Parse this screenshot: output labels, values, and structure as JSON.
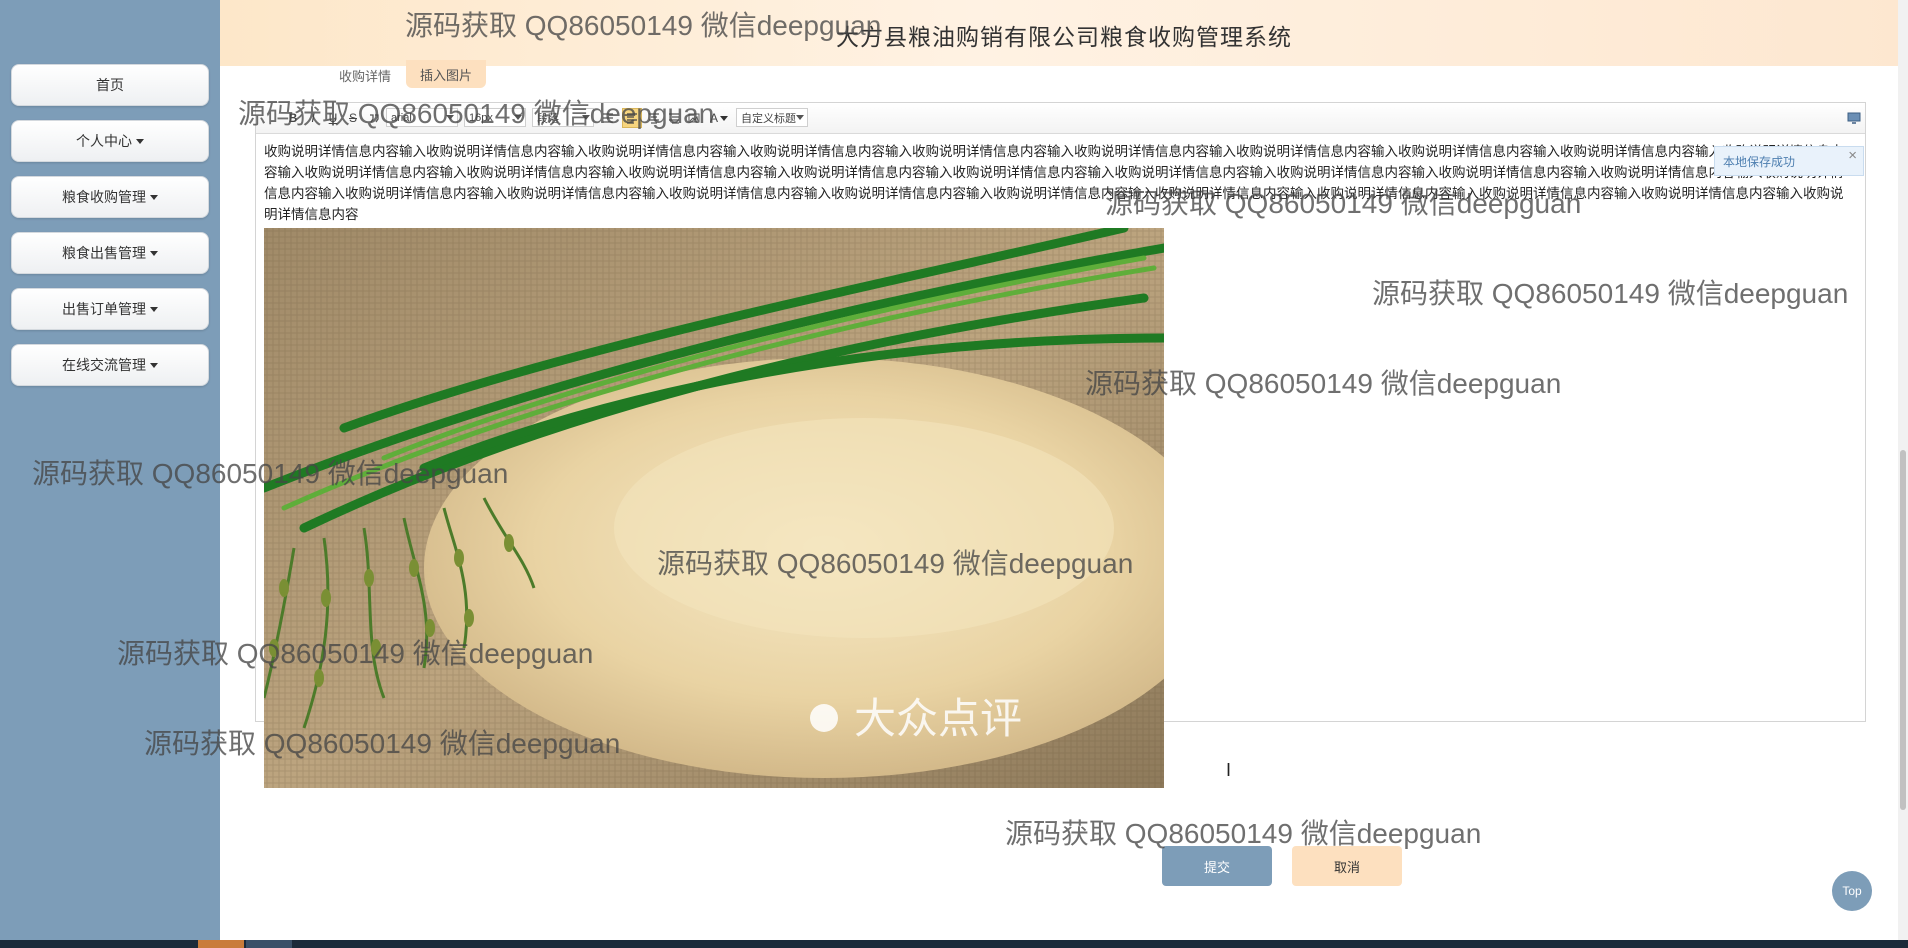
{
  "header": {
    "title": "大方县粮油购销有限公司粮食收购管理系统",
    "fullscreen_icon": "fullscreen-icon",
    "user_icon": "user-icon"
  },
  "sidebar": {
    "items": [
      {
        "label": "首页",
        "has_caret": false
      },
      {
        "label": "个人中心",
        "has_caret": true
      },
      {
        "label": "粮食收购管理",
        "has_caret": true
      },
      {
        "label": "粮食出售管理",
        "has_caret": true
      },
      {
        "label": "出售订单管理",
        "has_caret": true
      },
      {
        "label": "在线交流管理",
        "has_caret": true
      }
    ]
  },
  "form": {
    "field_label": "收购详情",
    "insert_image_label": "插入图片"
  },
  "editor": {
    "toolbar": {
      "bold": "B",
      "italic": "I",
      "underline": "U",
      "strike": "S",
      "font_family": "arial",
      "font_size": "16px",
      "paragraph": "段落",
      "custom_title": "自定义标题",
      "font_color": "A"
    },
    "content_text": "收购说明详情信息内容输入收购说明详情信息内容输入收购说明详情信息内容输入收购说明详情信息内容输入收购说明详情信息内容输入收购说明详情信息内容输入收购说明详情信息内容输入收购说明详情信息内容输入收购说明详情信息内容输入收购说明详情信息内容输入收购说明详情信息内容输入收购说明详情信息内容输入收购说明详情信息内容输入收购说明详情信息内容输入收购说明详情信息内容输入收购说明详情信息内容输入收购说明详情信息内容输入收购说明详情信息内容输入收购说明详情信息内容输入收购说明详情信息内容输入收购说明详情信息内容输入收购说明详情信息内容输入收购说明详情信息内容输入收购说明详情信息内容输入收购说明详情信息内容输入收购说明详情信息内容输入收购说明详情信息内容输入收购说明详情信息内容输入收购说明详情信息内容输入收购说明详情信息内容",
    "image_logo_text": "大众点评",
    "save_toast": "本地保存成功",
    "toast_close": "×"
  },
  "actions": {
    "submit": "提交",
    "cancel": "取消",
    "top": "Top"
  },
  "watermark": "源码获取 QQ86050149 微信deepguan",
  "colors": {
    "sidebar": "#7d9db8",
    "header_gradient_start": "#fde7c9",
    "cancel_button": "#fde0bf",
    "submit_button": "#7d9db8"
  }
}
